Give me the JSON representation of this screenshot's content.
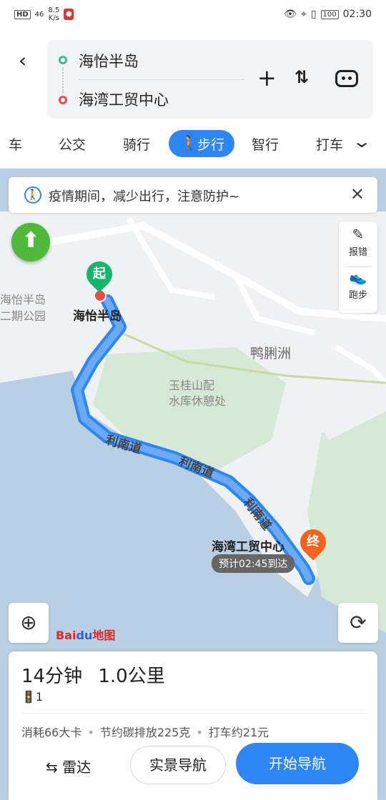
{
  "status_bar": {
    "network": "HD",
    "signal": "46",
    "speed": "8.5",
    "speed_unit": "K/s",
    "battery": "100",
    "time": "02:30"
  },
  "route": {
    "start": "海怡半岛",
    "end": "海湾工贸中心"
  },
  "modes": [
    "车",
    "公交",
    "骑行",
    "步行",
    "智行",
    "打车"
  ],
  "active_mode": "步行",
  "notice": "疫情期间，减少出行，注意防护~",
  "side_tools": {
    "report": "报错",
    "run": "跑步"
  },
  "map": {
    "start_pin": "起",
    "end_pin": "终",
    "start_label": "海怡半岛",
    "end_label": "海湾工贸中心",
    "eta": "预计02:45到达",
    "poi_left_1": "海怡半岛",
    "poi_left_2": "二期公园",
    "poi_island": "鸭脷洲",
    "poi_reservoir_1": "玉桂山配",
    "poi_reservoir_2": "水库休憩处",
    "road_1": "利南道",
    "road_2": "利南道",
    "road_3": "利南道",
    "logo_a": "Bai",
    "logo_b": "du",
    "logo_c": "地图"
  },
  "summary": {
    "duration": "14分钟",
    "distance": "1.0公里",
    "traffic_lights": "1"
  },
  "stats": [
    "消耗66大卡",
    "节约碳排放225克",
    "打车约21元"
  ],
  "actions": {
    "radar": "雷达",
    "ar_nav": "实景导航",
    "start_nav": "开始导航"
  },
  "colors": {
    "primary": "#2e86f5",
    "start": "#16b56c",
    "end": "#f4641f"
  }
}
